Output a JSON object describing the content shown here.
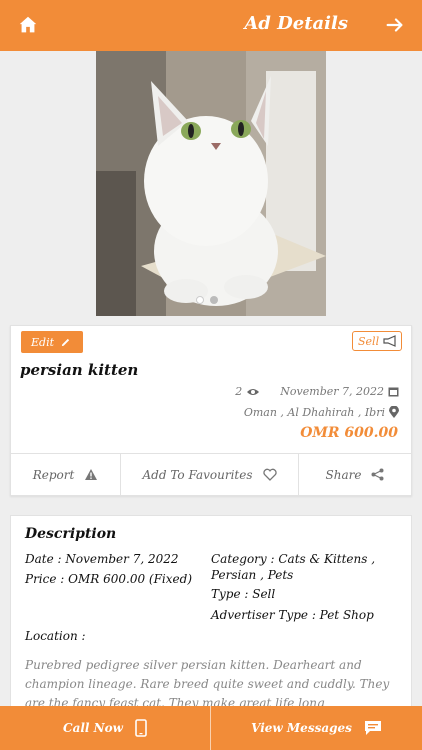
{
  "header": {
    "title": "Ad Details",
    "home_icon": "home-icon",
    "forward_icon": "arrow-right-icon"
  },
  "colors": {
    "accent": "#f28c38",
    "price": "#f28c38",
    "muted": "#777777"
  },
  "gallery": {
    "image_count": 2,
    "active_index": 0
  },
  "ad": {
    "edit_label": "Edit",
    "type_badge": "Sell",
    "title": "persian kitten",
    "views": "2",
    "date": "November 7, 2022",
    "location": "Oman , Al Dhahirah , Ibri",
    "price": "OMR 600.00"
  },
  "actions": {
    "report": "Report",
    "favourite": "Add To Favourites",
    "share": "Share"
  },
  "details": {
    "heading": "Description",
    "date": "Date : November 7, 2022",
    "price": "Price : OMR 600.00 (Fixed)",
    "category_line1": "Category : Cats & Kittens ,",
    "category_line2": "Persian , Pets",
    "type": "Type : Sell",
    "advertiser": "Advertiser Type : Pet Shop",
    "location_label": "Location :",
    "description": "Purebred pedigree silver persian kitten. Dearheart and champion lineage. Rare breed  quite  sweet and cuddly. They are the fancy feast cat. They make great life long"
  },
  "bottom": {
    "call": "Call Now",
    "messages": "View Messages"
  }
}
